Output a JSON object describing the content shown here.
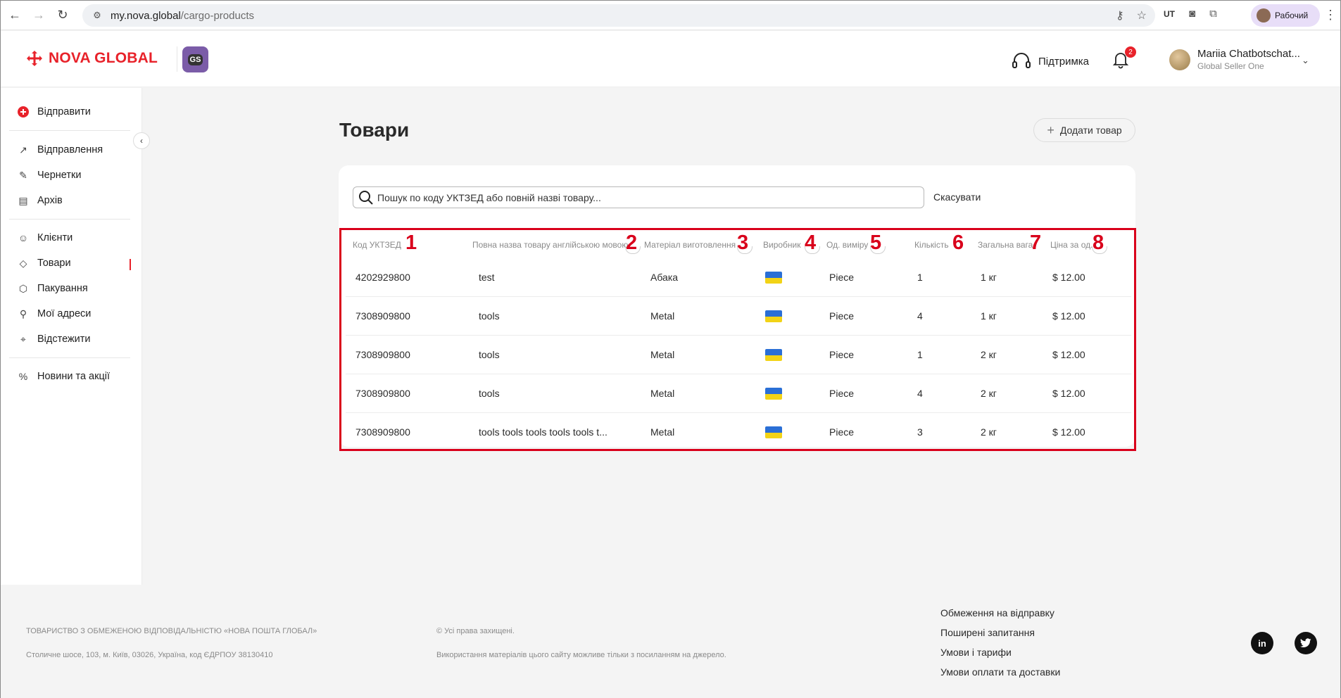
{
  "browser": {
    "url_host": "my.nova.global",
    "url_path": "/cargo-products",
    "profile_label": "Рабочий"
  },
  "header": {
    "logo_text": "NOVA GLOBAL",
    "badge_text": "GS",
    "support_label": "Підтримка",
    "notifications_count": "2",
    "user_name": "Mariia Chatbotschat...",
    "user_role": "Global Seller One"
  },
  "sidebar": {
    "send_label": "Відправити",
    "items": [
      {
        "label": "Відправлення",
        "icon": "arrow-up-right-icon"
      },
      {
        "label": "Чернетки",
        "icon": "edit-icon"
      },
      {
        "label": "Архів",
        "icon": "archive-icon"
      },
      {
        "label": "Клієнти",
        "icon": "users-icon"
      },
      {
        "label": "Товари",
        "icon": "tag-icon",
        "active": true
      },
      {
        "label": "Пакування",
        "icon": "package-icon"
      },
      {
        "label": "Мої адреси",
        "icon": "map-pin-icon"
      },
      {
        "label": "Відстежити",
        "icon": "crosshair-icon"
      },
      {
        "label": "Новини та акції",
        "icon": "percent-icon"
      }
    ]
  },
  "main": {
    "title": "Товари",
    "add_button": "Додати товар",
    "search_placeholder": "Пошук по коду УКТЗЕД або повній назві товару...",
    "cancel_label": "Скасувати",
    "columns": [
      {
        "label": "Код УКТЗЕД",
        "marker": "1"
      },
      {
        "label": "Повна назва товару англійською мовою",
        "marker": "2"
      },
      {
        "label": "Матеріал виготовлення",
        "marker": "3"
      },
      {
        "label": "Виробник",
        "marker": "4"
      },
      {
        "label": "Од. виміру",
        "marker": "5"
      },
      {
        "label": "Кількість",
        "marker": "6"
      },
      {
        "label": "Загальна вага",
        "marker": "7"
      },
      {
        "label": "Ціна за од.",
        "marker": "8"
      }
    ],
    "rows": [
      {
        "code": "4202929800",
        "name": "test",
        "material": "Абака",
        "manufacturer": "ukraine-flag-icon",
        "unit": "Piece",
        "qty": "1",
        "weight": "1 кг",
        "price": "$ 12.00"
      },
      {
        "code": "7308909800",
        "name": "tools",
        "material": "Metal",
        "manufacturer": "ukraine-flag-icon",
        "unit": "Piece",
        "qty": "4",
        "weight": "1 кг",
        "price": "$ 12.00"
      },
      {
        "code": "7308909800",
        "name": "tools",
        "material": "Metal",
        "manufacturer": "ukraine-flag-icon",
        "unit": "Piece",
        "qty": "1",
        "weight": "2 кг",
        "price": "$ 12.00"
      },
      {
        "code": "7308909800",
        "name": "tools",
        "material": "Metal",
        "manufacturer": "ukraine-flag-icon",
        "unit": "Piece",
        "qty": "4",
        "weight": "2 кг",
        "price": "$ 12.00"
      },
      {
        "code": "7308909800",
        "name": "tools tools tools tools tools t...",
        "material": "Metal",
        "manufacturer": "ukraine-flag-icon",
        "unit": "Piece",
        "qty": "3",
        "weight": "2 кг",
        "price": "$ 12.00"
      }
    ]
  },
  "footer": {
    "company": "ТОВАРИСТВО З ОБМЕЖЕНОЮ ВІДПОВІДАЛЬНІСТЮ «НОВА ПОШТА ГЛОБАЛ»",
    "address": "Столичне шосе, 103, м. Київ, 03026, Україна, код ЄДРПОУ 38130410",
    "rights": "© Усі права захищені.",
    "usage": "Використання матеріалів цього сайту можливе тільки з посиланням на джерело.",
    "links": [
      "Обмеження на відправку",
      "Поширені запитання",
      "Умови і тарифи",
      "Умови оплати та доставки"
    ],
    "social": [
      "linkedin-icon",
      "twitter-icon"
    ]
  },
  "colors": {
    "brand_red": "#e8222a",
    "highlight_red": "#d9001b",
    "gs_purple": "#7b5ca8",
    "flag_blue": "#2a6fd6",
    "flag_yellow": "#f2d316"
  }
}
